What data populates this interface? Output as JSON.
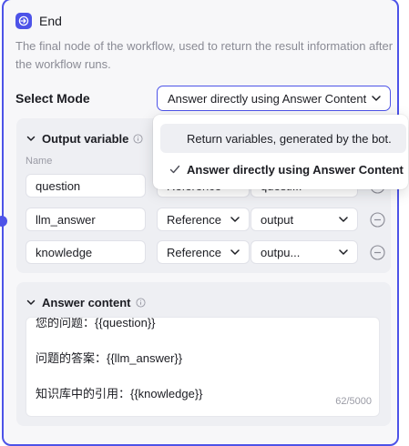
{
  "node": {
    "title": "End",
    "description": "The final node of the workflow, used to return the result information after the workflow runs.",
    "accent_color": "#4d53e8",
    "icon": "end-exit-icon"
  },
  "select_mode": {
    "label": "Select Mode",
    "current": "Answer directly using Answer Content",
    "options": [
      {
        "label": "Return variables, generated by the bot.",
        "selected": false
      },
      {
        "label": "Answer directly using Answer Content",
        "selected": true
      }
    ]
  },
  "output_variable": {
    "title": "Output variable",
    "column_name": "Name",
    "rows": [
      {
        "name": "question",
        "type": "Reference",
        "value": "questi..."
      },
      {
        "name": "llm_answer",
        "type": "Reference",
        "value": "output"
      },
      {
        "name": "knowledge",
        "type": "Reference",
        "value": "outpu..."
      }
    ]
  },
  "answer_content": {
    "title": "Answer content",
    "lines": [
      "您的问题：{{question}}",
      "",
      "问题的答案：{{llm_answer}}",
      "",
      "知识库中的引用：{{knowledge}}"
    ],
    "char_count": "62/5000"
  }
}
